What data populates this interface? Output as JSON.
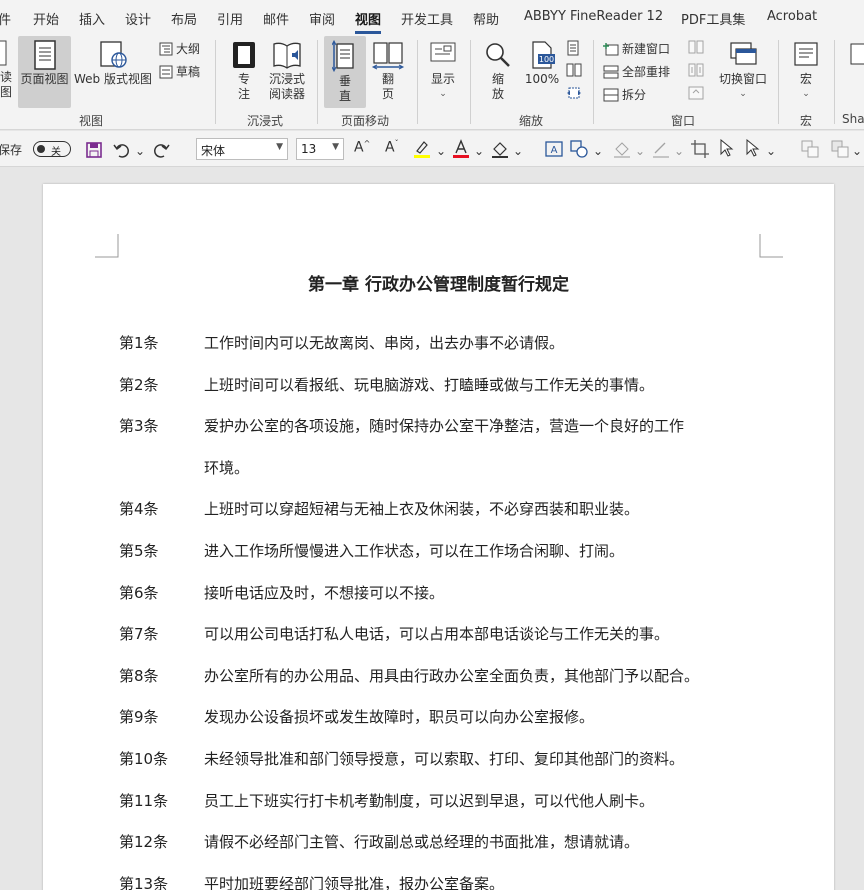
{
  "tabs": [
    "件",
    "开始",
    "插入",
    "设计",
    "布局",
    "引用",
    "邮件",
    "审阅",
    "视图",
    "开发工具",
    "帮助",
    "ABBYY FineReader 12",
    "PDF工具集",
    "Acrobat"
  ],
  "active_tab": "视图",
  "ribbon": {
    "view_group": {
      "label": "视图",
      "read_mode": "读\n图",
      "read_mode_a": "读",
      "read_mode_b": "图",
      "print_layout": "页面视图",
      "web_layout": "Web 版式视图",
      "outline": "大纲",
      "draft": "草稿"
    },
    "immersive_group": {
      "label": "沉浸式",
      "focus_a": "专",
      "focus_b": "注",
      "reader_a": "沉浸式",
      "reader_b": "阅读器"
    },
    "page_move_group": {
      "label": "页面移动",
      "vertical_a": "垂",
      "vertical_b": "直",
      "flip_a": "翻",
      "flip_b": "页"
    },
    "show_group": {
      "show": "显示"
    },
    "zoom_group": {
      "label": "缩放",
      "zoom_a": "缩",
      "zoom_b": "放",
      "percent": "100%",
      "percent_icon": "100"
    },
    "window_group": {
      "label": "窗口",
      "new_window": "新建窗口",
      "arrange_all": "全部重排",
      "split": "拆分",
      "switch_windows": "切换窗口"
    },
    "macro_group": {
      "label": "宏",
      "macro": "宏"
    },
    "share_group": {
      "label": "Sha"
    }
  },
  "qat": {
    "autosave": "保存",
    "toggle_state": "关",
    "font_name": "宋体",
    "font_size": "13"
  },
  "document": {
    "title": "第一章  行政办公管理制度暂行规定",
    "articles": [
      {
        "num": "第1条",
        "text": "工作时间内可以无故离岗、串岗，出去办事不必请假。"
      },
      {
        "num": "第2条",
        "text": "上班时间可以看报纸、玩电脑游戏、打瞌睡或做与工作无关的事情。"
      },
      {
        "num": "第3条",
        "text": "爱护办公室的各项设施，随时保持办公室干净整洁，营造一个良好的工作",
        "cont": "环境。"
      },
      {
        "num": "第4条",
        "text": "上班时可以穿超短裙与无袖上衣及休闲装，不必穿西装和职业装。"
      },
      {
        "num": "第5条",
        "text": "进入工作场所慢慢进入工作状态，可以在工作场合闲聊、打闹。"
      },
      {
        "num": "第6条",
        "text": "接听电话应及时，不想接可以不接。"
      },
      {
        "num": "第7条",
        "text": "可以用公司电话打私人电话，可以占用本部电话谈论与工作无关的事。"
      },
      {
        "num": "第8条",
        "text": "办公室所有的办公用品、用具由行政办公室全面负责，其他部门予以配合。"
      },
      {
        "num": "第9条",
        "text": "发现办公设备损坏或发生故障时，职员可以向办公室报修。"
      },
      {
        "num": "第10条",
        "text": "未经领导批准和部门领导授意，可以索取、打印、复印其他部门的资料。"
      },
      {
        "num": "第11条",
        "text": "员工上下班实行打卡机考勤制度，可以迟到早退，可以代他人刷卡。"
      },
      {
        "num": "第12条",
        "text": "请假不必经部门主管、行政副总或总经理的书面批准，想请就请。"
      },
      {
        "num": "第13条",
        "text": "平时加班要经部门领导批准，报办公室备案。"
      }
    ]
  },
  "colors": {
    "accent": "#2b579a",
    "highlight_yellow": "#ffff00",
    "font_red": "#e81123",
    "save_purple": "#7b2c8f"
  }
}
